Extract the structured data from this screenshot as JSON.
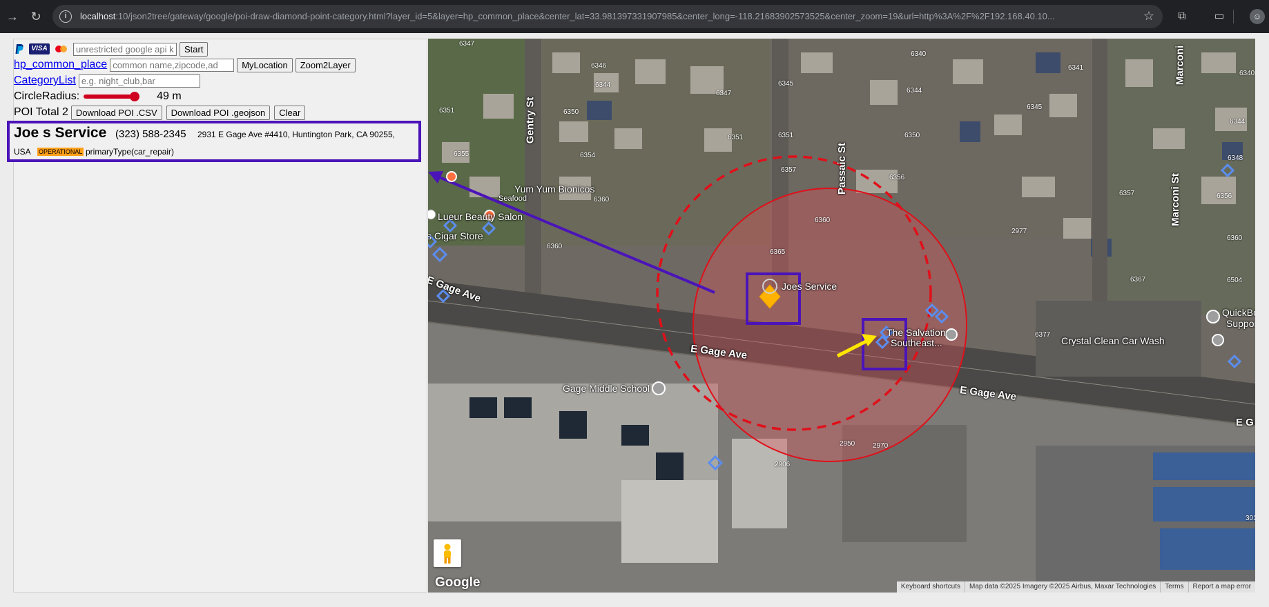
{
  "browser": {
    "url_host": "localhost",
    "url_rest": ":10/json2tree/gateway/google/poi-draw-diamond-point-category.html?layer_id=5&layer=hp_common_place&center_lat=33.981397331907985&center_long=-118.21683902573525&center_zoom=19&url=http%3A%2F%2F192.168.40.10..."
  },
  "controls": {
    "api_key_placeholder": "unrestricted google api key",
    "start_label": "Start",
    "layer_link": "hp_common_place",
    "search_placeholder": "common name,zipcode,ad",
    "mylocation_label": "MyLocation",
    "zoom2layer_label": "Zoom2Layer",
    "category_link": "CategoryList",
    "category_placeholder": "e.g. night_club,bar",
    "radius_label": "CircleRadius:",
    "radius_value": 49,
    "radius_fraction": 0.78,
    "radius_unit": "49 m",
    "poi_total": "POI Total 2",
    "download_csv_label": "Download POI .CSV",
    "download_geojson_label": "Download POI .geojson",
    "clear_label": "Clear"
  },
  "poi": {
    "name": "Joe s Service",
    "phone": "(323) 588-2345",
    "address": "2931 E Gage Ave #4410, Huntington Park, CA 90255,",
    "country": "USA",
    "status": "OPERATIONAL",
    "primary_type": "primaryType(car_repair)"
  },
  "map": {
    "place_labels": [
      "Yum Yum Bionicos",
      "Seafood",
      "Lueur Beauty Salon",
      "s Cigar Store",
      "Joes Service",
      "The Salvation",
      "Southeast...",
      "Gage Middle School",
      "Crystal Clean Car Wash",
      "QuickBo",
      "Suppor"
    ],
    "streets": [
      "Gentry St",
      "Passaic St",
      "Marconi St",
      "Marconi",
      "E Gage Ave",
      "E Gage Ave",
      "E Gage Ave",
      "E G"
    ],
    "parcel_numbers": [
      "6347",
      "6346",
      "6345",
      "6344",
      "6351",
      "6350",
      "6355",
      "6354",
      "6360",
      "6360",
      "6351",
      "6365",
      "6357",
      "6356",
      "6350",
      "6344",
      "6340",
      "6341",
      "6345",
      "6347",
      "6351",
      "6357",
      "6360",
      "6367",
      "6504",
      "6377",
      "2977",
      "6356",
      "6348",
      "6344",
      "6340",
      "6360",
      "2906",
      "2950",
      "2970",
      "301"
    ],
    "logo": "Google",
    "attribution": [
      "Keyboard shortcuts",
      "Map data ©2025 Imagery ©2025 Airbus, Maxar Technologies",
      "Terms",
      "Report a map error"
    ]
  },
  "colors": {
    "highlight_box": "#4b14b8",
    "status_badge": "#ff9f1a",
    "slider": "#d0001f",
    "circle_stroke": "#e0101a",
    "arrow_yellow": "#ffe600"
  }
}
